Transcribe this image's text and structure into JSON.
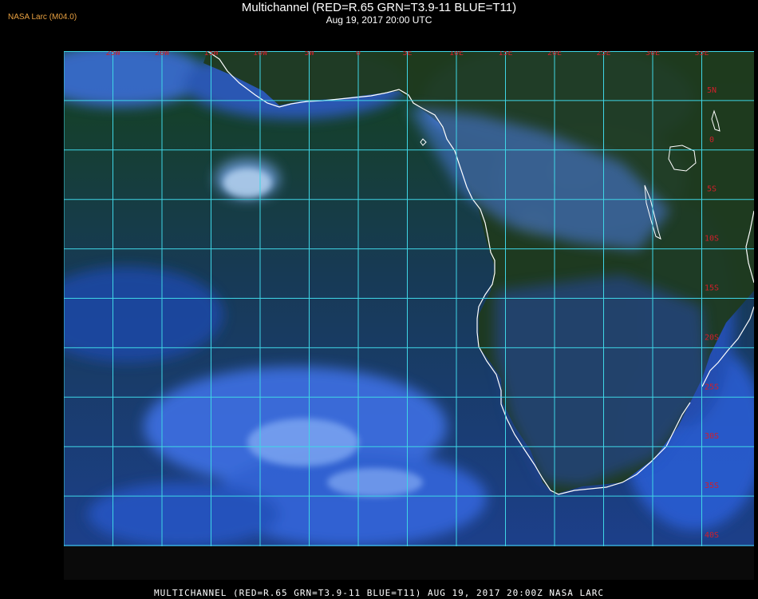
{
  "header": {
    "producer_tag": "NASA Larc (M04.0)",
    "title": "Multichannel (RED=R.65 GRN=T3.9-11 BLUE=T11)",
    "subtitle": "Aug 19, 2017 20:00 UTC"
  },
  "footer": {
    "caption": "MULTICHANNEL (RED=R.65 GRN=T3.9-11 BLUE=T11) AUG 19, 2017 20:00Z   NASA LARC"
  },
  "map": {
    "grid_color": "#3fd6e6",
    "label_color": "#d21f2a",
    "coast_color": "#ffffff",
    "land_color": "#1d3a1a",
    "ocean_color": "#1a3d7a",
    "cloud_color": "#5a8ff0",
    "longitude_labels": [
      "25W",
      "20W",
      "15W",
      "10W",
      "5W",
      "0",
      "5E",
      "10E",
      "15E",
      "20E",
      "25E",
      "30E",
      "35E"
    ],
    "latitude_labels": [
      "5N",
      "0",
      "5S",
      "10S",
      "15S",
      "20S",
      "25S",
      "30S",
      "35S",
      "40S"
    ]
  }
}
